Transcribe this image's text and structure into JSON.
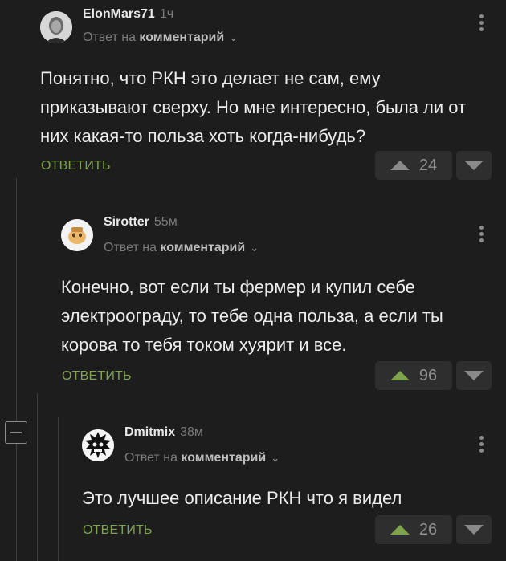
{
  "colors": {
    "background": "#1d1d1d",
    "accent": "#7ea34c",
    "muted": "#7b7b7b"
  },
  "comments": [
    {
      "author": "ElonMars71",
      "time": "1ч",
      "reply_prefix": "Ответ на",
      "reply_target": "комментарий",
      "text": "Понятно, что РКН это делает не сам, ему приказывают сверху. Но мне интересно, была ли от них какая-то польза хоть когда-нибудь?",
      "reply_label": "ОТВЕТИТЬ",
      "score": "24",
      "voted_up": false
    },
    {
      "author": "Sirotter",
      "time": "55м",
      "reply_prefix": "Ответ на",
      "reply_target": "комментарий",
      "text": "Конечно, вот если ты фермер и купил себе электроограду, то тебе одна польза, а если ты корова то тебя током хуярит и все.",
      "reply_label": "ОТВЕТИТЬ",
      "score": "96",
      "voted_up": true
    },
    {
      "author": "Dmitmix",
      "time": "38м",
      "reply_prefix": "Ответ на",
      "reply_target": "комментарий",
      "text": "Это лучшее описание РКН что я видел",
      "reply_label": "ОТВЕТИТЬ",
      "score": "26",
      "voted_up": true
    }
  ]
}
